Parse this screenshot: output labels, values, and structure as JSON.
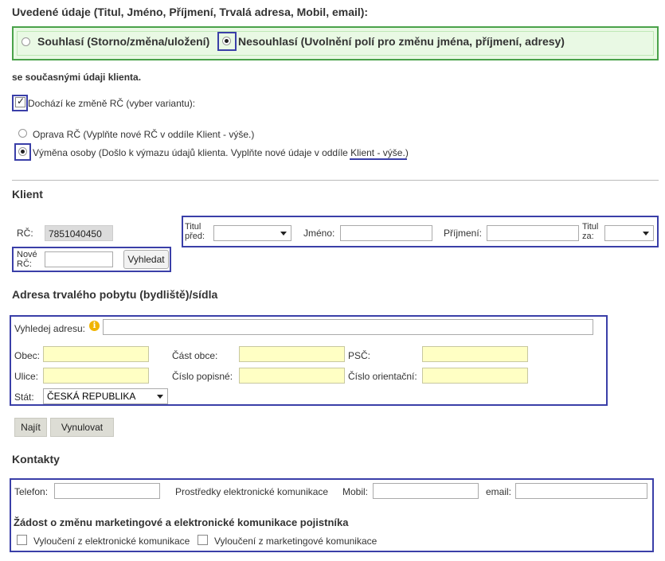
{
  "consent": {
    "title": "Uvedené údaje (Titul, Jméno, Příjmení, Trvalá adresa, Mobil, email):",
    "option_agree": "Souhlasí (Storno/změna/uložení)",
    "option_disagree": "Nesouhlasí (Uvolnění polí pro změnu jména, příjmení, adresy)",
    "subtext": "se současnými údaji klienta."
  },
  "rc_change": {
    "checkbox_label": "Dochází ke změně RČ (vyber variantu):",
    "option_fix": "Oprava RČ (Vyplňte nové RČ v oddíle Klient - výše.)",
    "option_swap_prefix": "Výměna osoby (Došlo k výmazu údajů klienta. Vyplňte nové údaje v oddíle ",
    "option_swap_link": "Klient - výše.",
    "option_swap_suffix": ")"
  },
  "client": {
    "title": "Klient",
    "rc_label": "RČ:",
    "rc_value": "7851040450",
    "title_before_label_1": "Titul",
    "title_before_label_2": "před:",
    "first_name_label": "Jméno:",
    "last_name_label": "Příjmení:",
    "title_after_label_1": "Titul",
    "title_after_label_2": "za:",
    "new_rc_label_1": "Nové",
    "new_rc_label_2": "RČ:",
    "search_button": "Vyhledat"
  },
  "address": {
    "title": "Adresa trvalého pobytu (bydliště)/sídla",
    "search_label": "Vyhledej adresu:",
    "obec_label": "Obec:",
    "cast_obce_label": "Část obce:",
    "psc_label": "PSČ:",
    "ulice_label": "Ulice:",
    "cislo_popisne_label": "Číslo popisné:",
    "cislo_orientacni_label": "Číslo orientační:",
    "stat_label": "Stát:",
    "stat_value": "ČESKÁ REPUBLIKA",
    "find_button": "Najít",
    "reset_button": "Vynulovat"
  },
  "contacts": {
    "title": "Kontakty",
    "phone_label": "Telefon:",
    "ecomm_label": "Prostředky elektronické komunikace",
    "mobile_label": "Mobil:",
    "email_label": "email:",
    "request_title": "Žádost o změnu marketingové a elektronické komunikace pojistníka",
    "exclude_electronic": "Vyloučení z elektronické komunikace",
    "exclude_marketing": "Vyloučení z marketingové komunikace"
  },
  "colors": {
    "highlight_border": "#3a3fa8",
    "consent_bg": "#e9f9e4",
    "consent_border": "#4aa24a",
    "required_field_bg": "#ffffc4"
  }
}
